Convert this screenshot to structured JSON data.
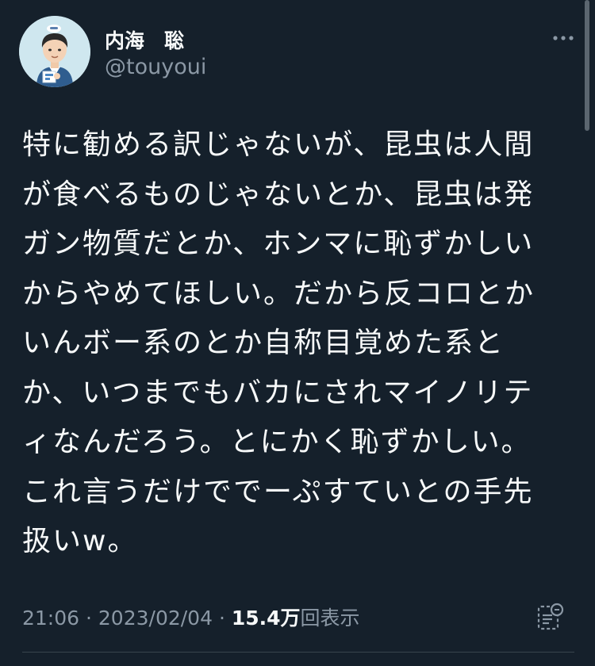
{
  "user": {
    "display_name": "内海　聡",
    "handle": "@touyoui"
  },
  "tweet": {
    "lines": [
      "特に勧める訳じゃないが、昆虫は人間",
      "が食べるものじゃないとか、昆虫は発",
      "ガン物質だとか、ホンマに恥ずかしい",
      "からやめてほしい。だから反コロとか",
      "いんボー系のとか自称目覚めた系と",
      "か、いつまでもバカにされマイノリテ",
      "ィなんだろう。とにかく恥ずかしい。",
      "これ言うだけででーぷすていとの手先",
      "扱いw。"
    ]
  },
  "meta": {
    "time": "21:06",
    "separator": "·",
    "date": "2023/02/04",
    "views_count": "15.4万",
    "views_label": "回表示"
  },
  "icons": {
    "more": "more-horizontal-icon",
    "analytics": "analytics-icon"
  },
  "colors": {
    "background": "#15202b",
    "text": "#f7f9f9",
    "secondary_text": "#8b98a5"
  }
}
